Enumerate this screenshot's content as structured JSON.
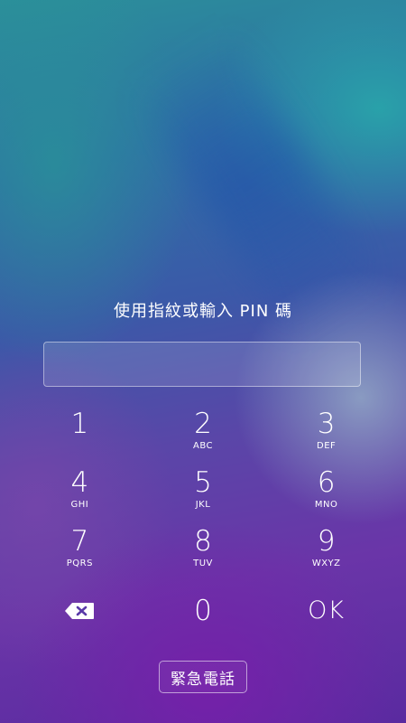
{
  "lock_screen": {
    "prompt": "使用指紋或輸入 PIN 碼",
    "pin_input": {
      "value": "",
      "placeholder": ""
    },
    "keypad": {
      "keys": [
        {
          "digit": "1",
          "letters": ""
        },
        {
          "digit": "2",
          "letters": "ABC"
        },
        {
          "digit": "3",
          "letters": "DEF"
        },
        {
          "digit": "4",
          "letters": "GHI"
        },
        {
          "digit": "5",
          "letters": "JKL"
        },
        {
          "digit": "6",
          "letters": "MNO"
        },
        {
          "digit": "7",
          "letters": "PQRS"
        },
        {
          "digit": "8",
          "letters": "TUV"
        },
        {
          "digit": "9",
          "letters": "WXYZ"
        }
      ],
      "backspace_icon": "backspace-icon",
      "zero": "0",
      "ok_label": "OK"
    },
    "emergency_call_label": "緊急電話"
  },
  "colors": {
    "text": "#ffffff",
    "field_border": "#c8cdd8"
  }
}
